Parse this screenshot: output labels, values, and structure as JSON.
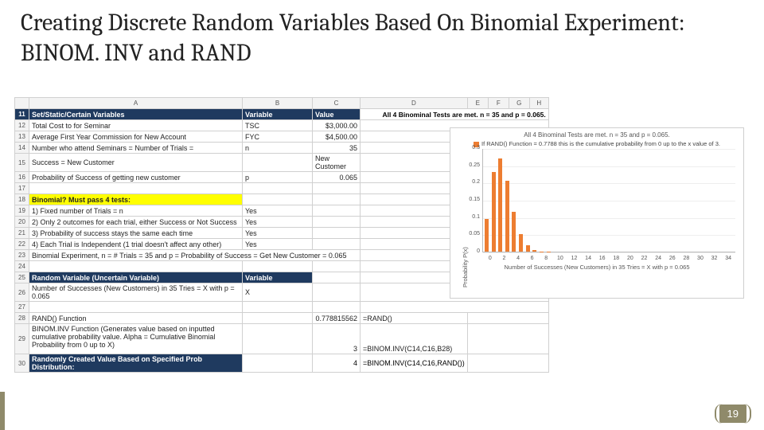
{
  "title": "Creating Discrete Random Variables Based On Binomial Experiment: BINOM. INV and RAND",
  "page_number": "19",
  "col_headers": [
    "",
    "A",
    "B",
    "C",
    "D",
    "E",
    "F",
    "G",
    "H"
  ],
  "top_note": "All 4 Binominal Tests are met. n = 35 and p = 0.065.",
  "rows": {
    "11": {
      "a": "Set/Static/Certain Variables",
      "b": "Variable",
      "c": "Value"
    },
    "12": {
      "a": "Total Cost to for Seminar",
      "b": "TSC",
      "c": "$3,000.00"
    },
    "13": {
      "a": "Average First Year Commission for New Account",
      "b": "FYC",
      "c": "$4,500.00"
    },
    "14": {
      "a": "Number who attend Seminars =  Number of Trials =",
      "b": "n",
      "c": "35"
    },
    "15": {
      "a": "Success = New Customer",
      "b": "",
      "c": "New Customer"
    },
    "16": {
      "a": "Probability of Success of getting new customer",
      "b": "p",
      "c": "0.065"
    },
    "18": {
      "a": "Binomial? Must pass 4 tests:"
    },
    "19": {
      "a": "1) Fixed number of Trials = n",
      "b": "Yes"
    },
    "20": {
      "a": "2) Only 2 outcomes for each trial, either Success or Not Success",
      "b": "Yes"
    },
    "21": {
      "a": "3) Probability of success stays the same each time",
      "b": "Yes"
    },
    "22": {
      "a": "4) Each Trial is Independent (1 trial doesn't affect any other)",
      "b": "Yes"
    },
    "23": {
      "a": "Binomial Experiment, n = # Trials = 35 and p = Probability of Success = Get New Customer = 0.065"
    },
    "25": {
      "a": "Random Variable (Uncertain Variable)",
      "b": "Variable"
    },
    "26": {
      "a": "Number of Successes (New Customers) in 35 Tries = X with p = 0.065",
      "b": "X"
    },
    "28": {
      "a": "RAND() Function",
      "c": "0.778815562",
      "d": "=RAND()"
    },
    "29": {
      "a": "BINOM.INV Function (Generates value based on inputted cumulative probability value. Alpha = Cumulative Binomial Probability from 0 up to X)",
      "c": "3",
      "d": "=BINOM.INV(C14,C16,B28)"
    },
    "30": {
      "a": "Randomly Created Value Based on Specified Prob Distribution:",
      "c": "4",
      "d": "=BINOM.INV(C14,C16,RAND())"
    }
  },
  "chart_data": {
    "type": "bar",
    "title": "All 4 Binominal Tests are met. n = 35 and p = 0.065.",
    "legend": "If RAND() Function = 0.7788 this is the cumulative probability from 0 up to the x value of 3.",
    "xlabel": "Number of Successes (New Customers) in 35 Tries = X with p = 0.065",
    "ylabel": "Probability P(x)",
    "ylim": [
      0,
      0.3
    ],
    "yticks": [
      0,
      0.05,
      0.1,
      0.15,
      0.2,
      0.25,
      0.3
    ],
    "categories": [
      0,
      2,
      4,
      6,
      8,
      10,
      12,
      14,
      16,
      18,
      20,
      22,
      24,
      26,
      28,
      30,
      32,
      34
    ],
    "x_all": [
      0,
      1,
      2,
      3,
      4,
      5,
      6,
      7,
      8,
      9,
      10
    ],
    "values": [
      0.095,
      0.23,
      0.27,
      0.205,
      0.115,
      0.05,
      0.018,
      0.005,
      0.001,
      0.0003,
      0.0001
    ]
  }
}
